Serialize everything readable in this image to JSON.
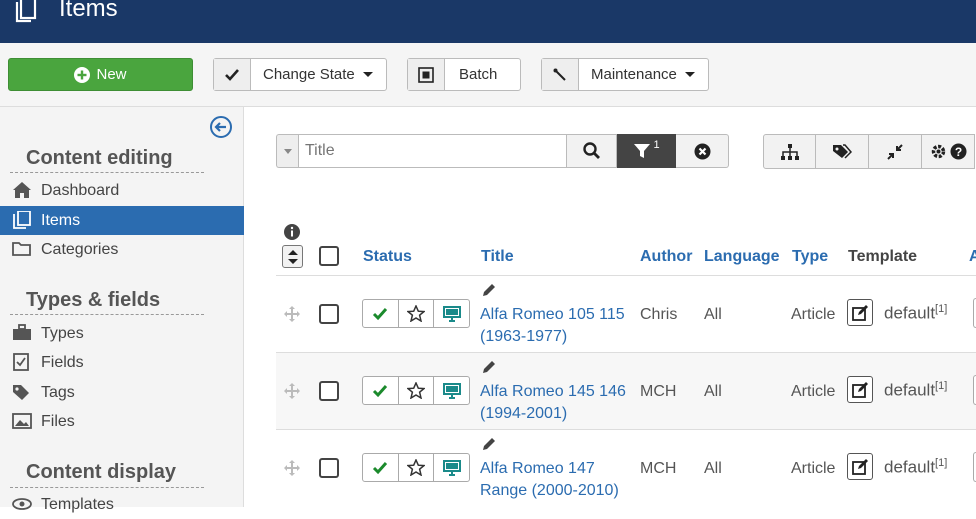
{
  "header": {
    "title": "Items",
    "icon": "copy-icon"
  },
  "toolbar": {
    "new_label": "New",
    "change_state_label": "Change State",
    "batch_label": "Batch",
    "maintenance_label": "Maintenance",
    "new_color": "#4aa53e"
  },
  "sidebar": {
    "sections": [
      {
        "title": "Content editing",
        "items": [
          {
            "label": "Dashboard",
            "icon": "home-icon",
            "active": false
          },
          {
            "label": "Items",
            "icon": "copy-icon",
            "active": true
          },
          {
            "label": "Categories",
            "icon": "folder-icon",
            "active": false
          }
        ]
      },
      {
        "title": "Types & fields",
        "items": [
          {
            "label": "Types",
            "icon": "briefcase-icon"
          },
          {
            "label": "Fields",
            "icon": "checklist-icon"
          },
          {
            "label": "Tags",
            "icon": "tags-icon"
          },
          {
            "label": "Files",
            "icon": "image-icon"
          }
        ]
      },
      {
        "title": "Content display",
        "items": [
          {
            "label": "Templates",
            "icon": "eye-icon"
          }
        ]
      }
    ]
  },
  "filter": {
    "placeholder": "Title",
    "filter_count": "1"
  },
  "table": {
    "columns": {
      "status": "Status",
      "title": "Title",
      "author": "Author",
      "language": "Language",
      "type": "Type",
      "template": "Template",
      "more": "A"
    },
    "rows": [
      {
        "title_line1": "Alfa Romeo 105 115",
        "title_line2": "(1963-1977)",
        "author": "Chris",
        "language": "All",
        "type": "Article",
        "template": "default",
        "template_sup": "[1]"
      },
      {
        "title_line1": "Alfa Romeo 145 146",
        "title_line2": "(1994-2001)",
        "author": "MCH",
        "language": "All",
        "type": "Article",
        "template": "default",
        "template_sup": "[1]"
      },
      {
        "title_line1": "Alfa Romeo 147",
        "title_line2": "Range (2000-2010)",
        "author": "MCH",
        "language": "All",
        "type": "Article",
        "template": "default",
        "template_sup": "[1]"
      }
    ]
  }
}
